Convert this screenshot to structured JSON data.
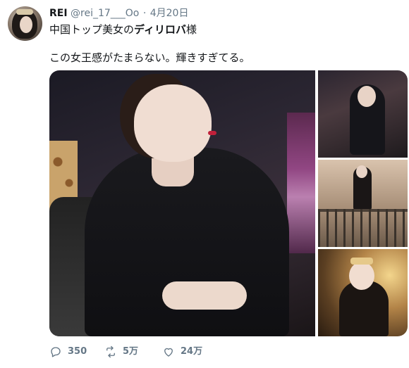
{
  "tweet": {
    "name": "REI",
    "handle": "@rei_17___Oo",
    "separator": "·",
    "date": "4月20日",
    "line1_prefix": "中国トップ美女の",
    "line1_bold": "ディリロバ",
    "line1_suffix": "様",
    "line2": "この女王感がたまらない。輝きすぎてる。"
  },
  "actions": {
    "replies": "350",
    "retweets": "5万",
    "likes": "24万"
  },
  "icons": {
    "reply": "reply-icon",
    "retweet": "retweet-icon",
    "like": "heart-icon"
  },
  "colors": {
    "text": "#14171a",
    "secondary": "#657786",
    "background": "#ffffff"
  }
}
